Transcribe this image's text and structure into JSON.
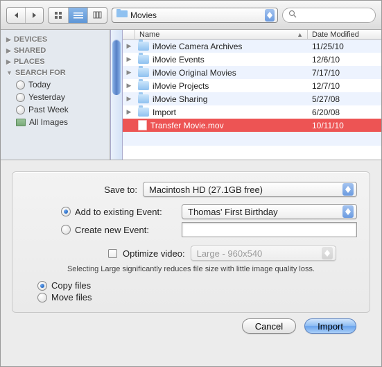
{
  "toolbar": {
    "folder_label": "Movies",
    "search_placeholder": ""
  },
  "sidebar": {
    "sections": [
      {
        "title": "DEVICES",
        "expanded": false
      },
      {
        "title": "SHARED",
        "expanded": false
      },
      {
        "title": "PLACES",
        "expanded": false
      },
      {
        "title": "SEARCH FOR",
        "expanded": true
      }
    ],
    "search_items": [
      "Today",
      "Yesterday",
      "Past Week",
      "All Images"
    ]
  },
  "columns": {
    "name": "Name",
    "date": "Date Modified"
  },
  "files": [
    {
      "name": "iMovie Camera Archives",
      "date": "11/25/10",
      "type": "folder"
    },
    {
      "name": "iMovie Events",
      "date": "12/6/10",
      "type": "folder"
    },
    {
      "name": "iMovie Original Movies",
      "date": "7/17/10",
      "type": "folder"
    },
    {
      "name": "iMovie Projects",
      "date": "12/7/10",
      "type": "folder"
    },
    {
      "name": "iMovie Sharing",
      "date": "5/27/08",
      "type": "folder"
    },
    {
      "name": "Import",
      "date": "6/20/08",
      "type": "folder"
    },
    {
      "name": "Transfer Movie.mov",
      "date": "10/11/10",
      "type": "file",
      "selected": true
    }
  ],
  "options": {
    "save_to_label": "Save to:",
    "save_to_value": "Macintosh HD (27.1GB free)",
    "add_existing_label": "Add to existing Event:",
    "existing_event_value": "Thomas' First Birthday",
    "create_new_label": "Create new Event:",
    "create_new_value": "",
    "optimize_label": "Optimize video:",
    "optimize_value": "Large - 960x540",
    "hint": "Selecting Large significantly reduces file size with little image quality loss.",
    "copy_label": "Copy files",
    "move_label": "Move files"
  },
  "footer": {
    "cancel": "Cancel",
    "import": "Import"
  }
}
